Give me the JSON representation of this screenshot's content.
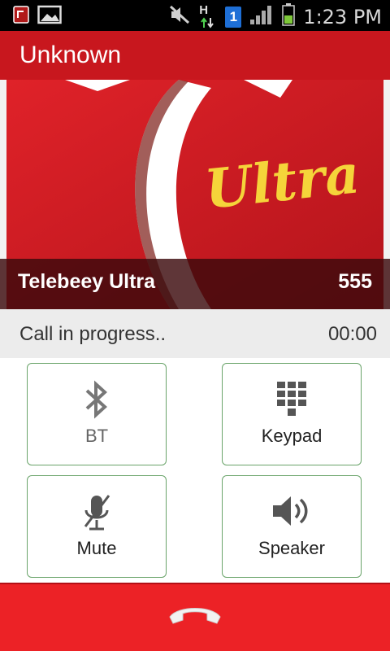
{
  "status_bar": {
    "time": "1:23 PM",
    "icons": [
      "app-notification-icon",
      "picture-icon",
      "mute-icon",
      "data-hplus-icon",
      "sim-1-icon",
      "signal-icon",
      "battery-icon"
    ],
    "data_label": "H",
    "sim_label": "1"
  },
  "header": {
    "title": "Unknown"
  },
  "hero": {
    "brand_text": "Ultra",
    "contact_name": "Telebeey Ultra",
    "contact_number": "555"
  },
  "call": {
    "status_text": "Call in progress..",
    "timer": "00:00"
  },
  "controls": {
    "bt_label": "BT",
    "keypad_label": "Keypad",
    "mute_label": "Mute",
    "speaker_label": "Speaker"
  },
  "colors": {
    "brand_red": "#c8171e",
    "end_call_red": "#ec2226",
    "button_border": "#6aa46a",
    "brand_text_yellow": "#f5d43a"
  }
}
